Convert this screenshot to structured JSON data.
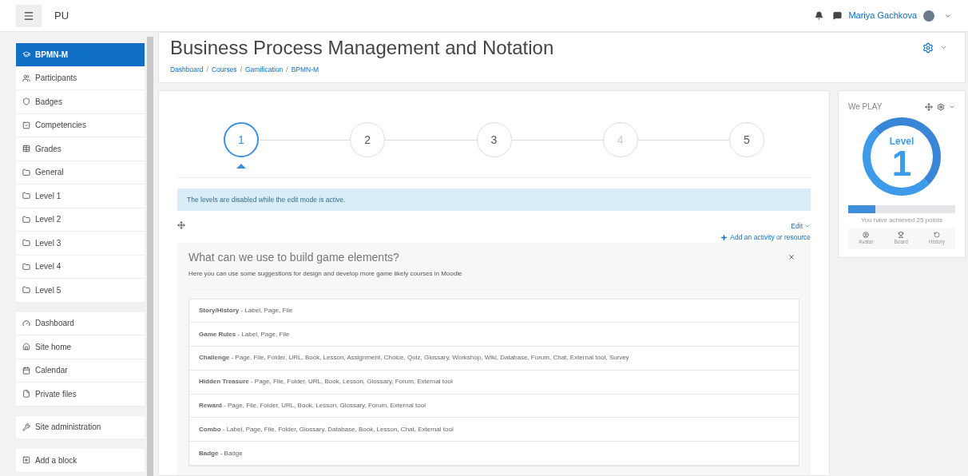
{
  "navbar": {
    "brand": "PU",
    "user": "Mariya Gachkova"
  },
  "sidebar": {
    "groups": [
      [
        {
          "label": "BPMN-M",
          "selected": true
        },
        {
          "label": "Participants",
          "selected": false
        },
        {
          "label": "Badges",
          "selected": false
        },
        {
          "label": "Competencies",
          "selected": false
        },
        {
          "label": "Grades",
          "selected": false
        },
        {
          "label": "General",
          "selected": false
        },
        {
          "label": "Level 1",
          "selected": false
        },
        {
          "label": "Level 2",
          "selected": false
        },
        {
          "label": "Level 3",
          "selected": false
        },
        {
          "label": "Level 4",
          "selected": false
        },
        {
          "label": "Level 5",
          "selected": false
        }
      ],
      [
        {
          "label": "Dashboard",
          "selected": false
        },
        {
          "label": "Site home",
          "selected": false
        },
        {
          "label": "Calendar",
          "selected": false
        },
        {
          "label": "Private files",
          "selected": false
        }
      ],
      [
        {
          "label": "Site administration",
          "selected": false
        }
      ],
      [
        {
          "label": "Add a block",
          "selected": false
        }
      ]
    ]
  },
  "header": {
    "title": "Business Process Management and Notation",
    "breadcrumb": [
      "Dashboard",
      "Courses",
      "Gamification",
      "BPMN-M"
    ],
    "separator": "/"
  },
  "levels": [
    {
      "label": "1",
      "selected": true,
      "disabled": false
    },
    {
      "label": "2",
      "selected": false,
      "disabled": false
    },
    {
      "label": "3",
      "selected": false,
      "disabled": false
    },
    {
      "label": "4",
      "selected": false,
      "disabled": true
    },
    {
      "label": "5",
      "selected": false,
      "disabled": false
    }
  ],
  "notice": "The levels are disabled while the edit mode is active.",
  "edit_link": "Edit",
  "add_activity": "Add an activity or resource",
  "section": {
    "title": "What can we use to build game elements?",
    "subtitle": "Here you can use some suggestions for design and develop more game likely courses in Moodle",
    "rows": [
      "**Story/History** - Label, Page, File",
      "**Game Rules** - Label, Page, File",
      "**Challenge** - Page, File, Folder, URL, Book, Lesson, Assignment, Choice, Quiz, Glossary, Workshop, Wiki, Database, Forum, Chat, External tool, Survey",
      "**Hidden Treasure** - Page, File, Folder, URL, Book, Lesson, Glossary, Forum, External tool",
      "**Reward** - Page, File, Folder, URL, Book, Lesson, Glossary, Forum, External tool",
      "**Combo** - Label, Page, File, Folder, Glossary, Database, Book, Lesson, Chat, External tool",
      "**Badge** - Badge"
    ]
  },
  "block": {
    "title": "We PLAY",
    "level_label": "Level",
    "level_number": "1",
    "progress": {
      "level": 0.25
    },
    "points": "You have achieved 25 points",
    "tabs": [
      {
        "label": "Avatar"
      },
      {
        "label": "Board"
      },
      {
        "label": "History"
      }
    ]
  }
}
